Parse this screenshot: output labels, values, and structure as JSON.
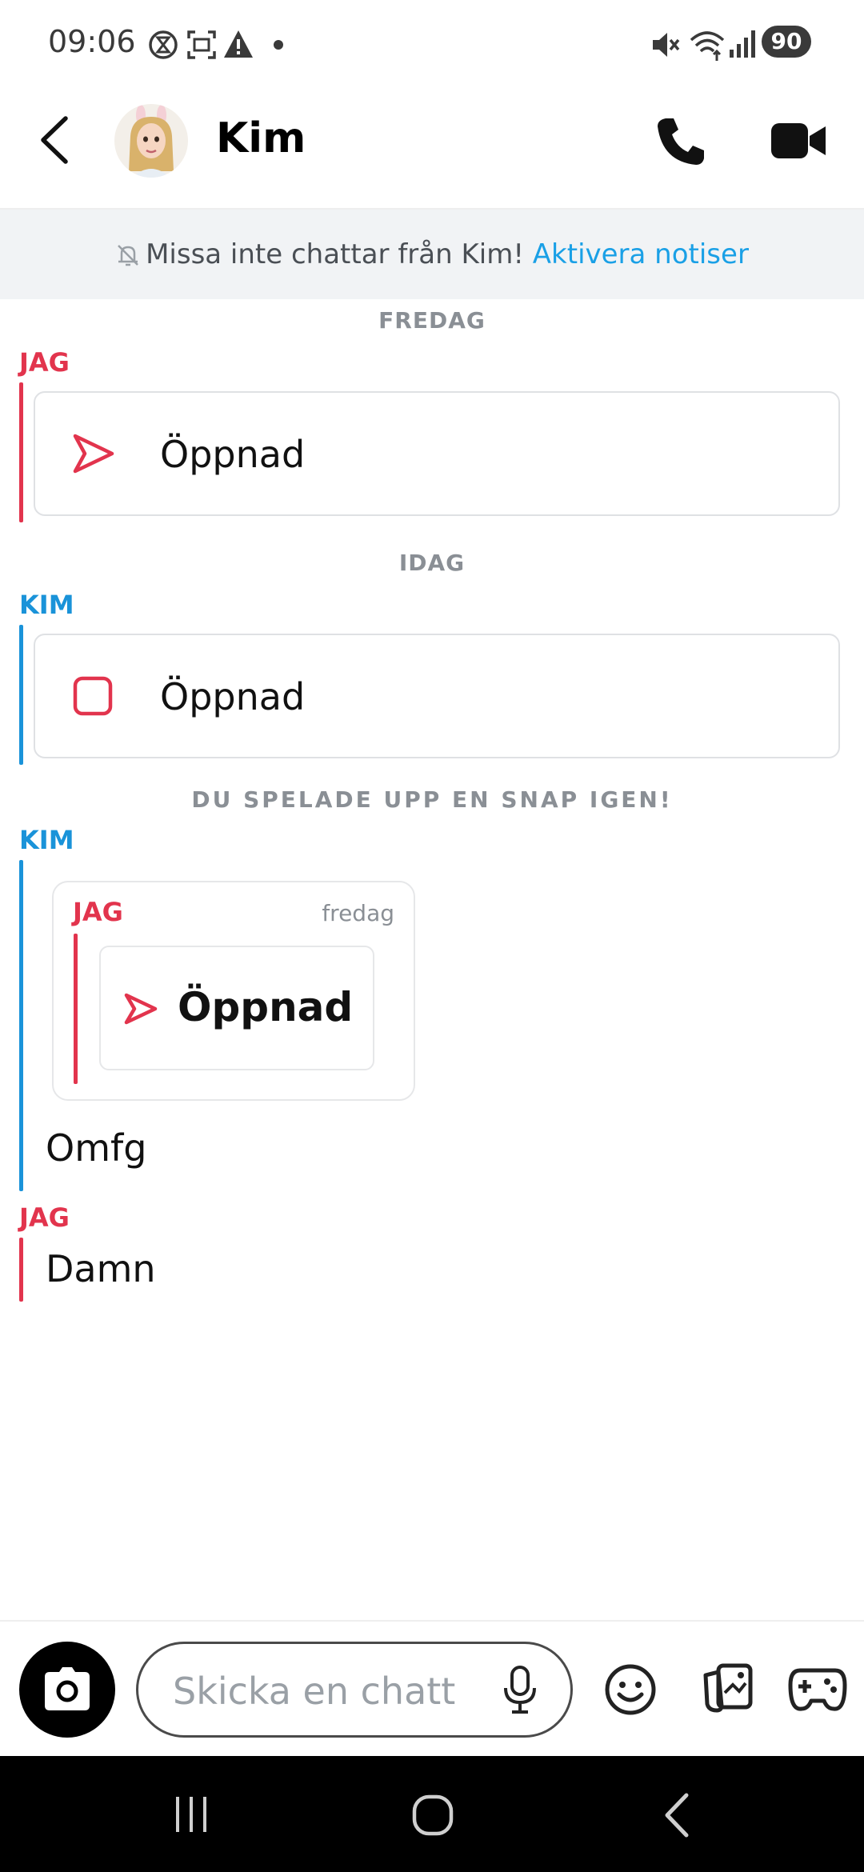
{
  "status_bar": {
    "time": "09:06",
    "battery": "90",
    "icons": [
      "timer-icon",
      "screenshot-icon",
      "warning-icon",
      "dot-icon",
      "mute-icon",
      "wifi-icon",
      "signal-icon"
    ]
  },
  "header": {
    "contact_name": "Kim",
    "icons": [
      "back-icon",
      "avatar",
      "phone-icon",
      "video-icon"
    ]
  },
  "notification_banner": {
    "text": "Missa inte chattar från Kim!",
    "link": "Aktivera notiser"
  },
  "chat": {
    "day_friday": "FREDAG",
    "sender_me_1": "JAG",
    "snap_1": "Öppnad",
    "day_today": "IDAG",
    "sender_kim_1": "KIM",
    "snap_2": "Öppnad",
    "replay_notice": "DU SPELADE UPP EN SNAP IGEN!",
    "sender_kim_2": "KIM",
    "quote": {
      "sender": "JAG",
      "time": "fredag",
      "label": "Öppnad"
    },
    "message_kim": "Omfg",
    "sender_me_2": "JAG",
    "message_me": "Damn"
  },
  "composer": {
    "placeholder": "Skicka en chatt",
    "icons": [
      "camera-icon",
      "microphone-icon",
      "emoji-icon",
      "sticker-icon",
      "game-icon"
    ]
  },
  "colors": {
    "me": "#e2344d",
    "friend": "#1a93d9",
    "link": "#1aa0e6"
  }
}
